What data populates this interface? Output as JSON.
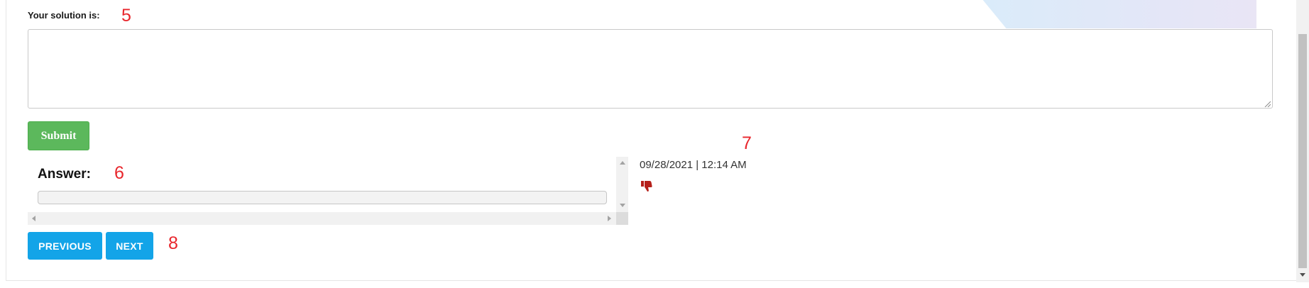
{
  "solution": {
    "label": "Your solution is:",
    "value": "",
    "submit_label": "Submit"
  },
  "answer": {
    "heading": "Answer:",
    "value": ""
  },
  "meta": {
    "timestamp": "09/28/2021 | 12:14 AM",
    "rating_icon": "thumbs-down-icon",
    "rating_color": "#b5201a"
  },
  "navigation": {
    "previous_label": "PREVIOUS",
    "next_label": "NEXT"
  },
  "markers": {
    "m5": "5",
    "m6": "6",
    "m7": "7",
    "m8": "8"
  },
  "colors": {
    "submit": "#5cb85c",
    "nav": "#13a4e8",
    "marker": "#e8262c"
  }
}
